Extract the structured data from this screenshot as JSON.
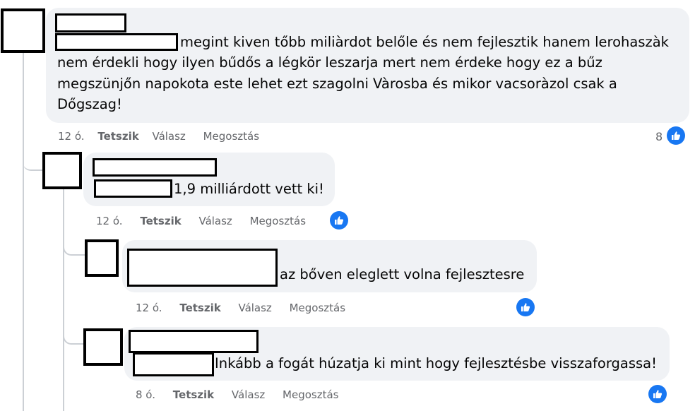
{
  "comments": [
    {
      "text_lines": [
        "megint kiven tőbb miliàrdot belőle és nem fejlesztik hanem lerohaszàk",
        "nem érdekli hogy ilyen bűdős a légkör leszarja mert nem érdeke hogy ez a bűz",
        "megszünjőn napokota este lehet ezt szagolni Vàrosba és mikor vacsoràzol csak a",
        "Dőgszag!"
      ],
      "time": "12 ó.",
      "like_label": "Tetszik",
      "reply_label": "Válasz",
      "share_label": "Megosztás",
      "reaction_count": "8"
    },
    {
      "text_lines": [
        "1,9 milliárdott vett ki!"
      ],
      "time": "12 ó.",
      "like_label": "Tetszik",
      "reply_label": "Válasz",
      "share_label": "Megosztás"
    },
    {
      "text_lines": [
        "az bőven eleglett volna fejlesztesre"
      ],
      "time": "12 ó.",
      "like_label": "Tetszik",
      "reply_label": "Válasz",
      "share_label": "Megosztás"
    },
    {
      "text_lines": [
        "Inkább a fogát húzatja ki mint hogy fejlesztésbe visszaforgassa!"
      ],
      "time": "8 ó.",
      "like_label": "Tetszik",
      "reply_label": "Válasz",
      "share_label": "Megosztás"
    }
  ],
  "colors": {
    "bubble_bg": "#f0f2f5",
    "reaction_blue": "#1877f2",
    "meta_text": "#65676b"
  },
  "icons": {
    "reaction": "thumbs-up-icon"
  }
}
